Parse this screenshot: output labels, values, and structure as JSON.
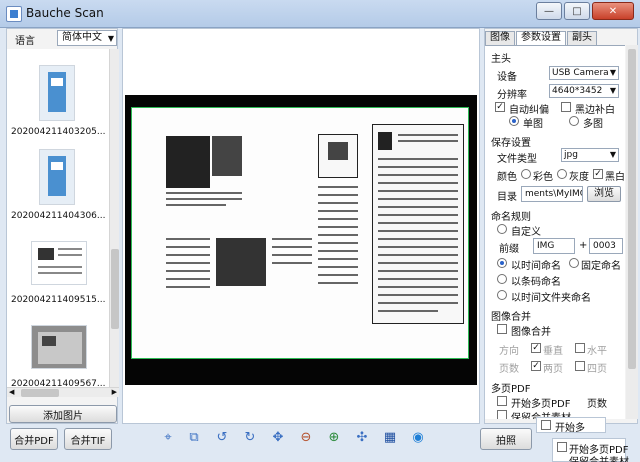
{
  "window": {
    "title": "Bauche Scan"
  },
  "left": {
    "language_label": "语言",
    "language_value": "简体中文",
    "thumbnails": [
      "202004211403205...",
      "202004211404306...",
      "202004211409515...",
      "202004211409567..."
    ],
    "add_button": "添加图片"
  },
  "toolbar": {
    "merge_pdf": "合并PDF",
    "merge_tif": "合并TIF",
    "shoot": "拍照",
    "icons": [
      "select-icon",
      "crop-icon",
      "rotate-left-icon",
      "rotate-right-icon",
      "move-icon",
      "zoom-out-icon",
      "zoom-in-icon",
      "fit-icon",
      "film-icon",
      "scan-icon"
    ]
  },
  "right": {
    "tabs": [
      "图像",
      "参数设置",
      "副头"
    ],
    "main_head": {
      "title": "主头",
      "device_label": "设备",
      "device_value": "USB Camera",
      "resolution_label": "分辨率",
      "resolution_value": "4640*3452",
      "auto_deskew": "自动纠偏",
      "black_fill": "黑边补白",
      "single": "单图",
      "multi": "多图"
    },
    "save": {
      "title": "保存设置",
      "file_type_label": "文件类型",
      "file_type_value": "jpg",
      "color_label": "颜色",
      "color": "彩色",
      "gray": "灰度",
      "bw": "黑白",
      "dir_label": "目录",
      "dir_value": "ments\\MyIMG",
      "browse": "浏览"
    },
    "naming": {
      "title": "命名规则",
      "custom": "自定义",
      "prefix_label": "前缀",
      "prefix_value": "IMG",
      "plus": "+",
      "counter_value": "0003",
      "by_time": "以时间命名",
      "fixed": "固定命名",
      "by_barcode": "以条码命名",
      "by_time_folder": "以时间文件夹命名"
    },
    "merge": {
      "title": "图像合并",
      "merge": "图像合并",
      "direction_label": "方向",
      "vertical": "垂直",
      "horizontal": "水平",
      "pages_label": "页数",
      "two_pages": "两页",
      "four_pages": "四页"
    },
    "multipage": {
      "title": "多页PDF",
      "start_multi": "开始多页PDF",
      "page_count_label": "页数",
      "keep_source": "保留合并素材"
    }
  },
  "overflow": {
    "start_multi_short": "开始多",
    "start_multi_pdf": "开始多页PDF",
    "keep_source_cut": "保留合并素材"
  }
}
